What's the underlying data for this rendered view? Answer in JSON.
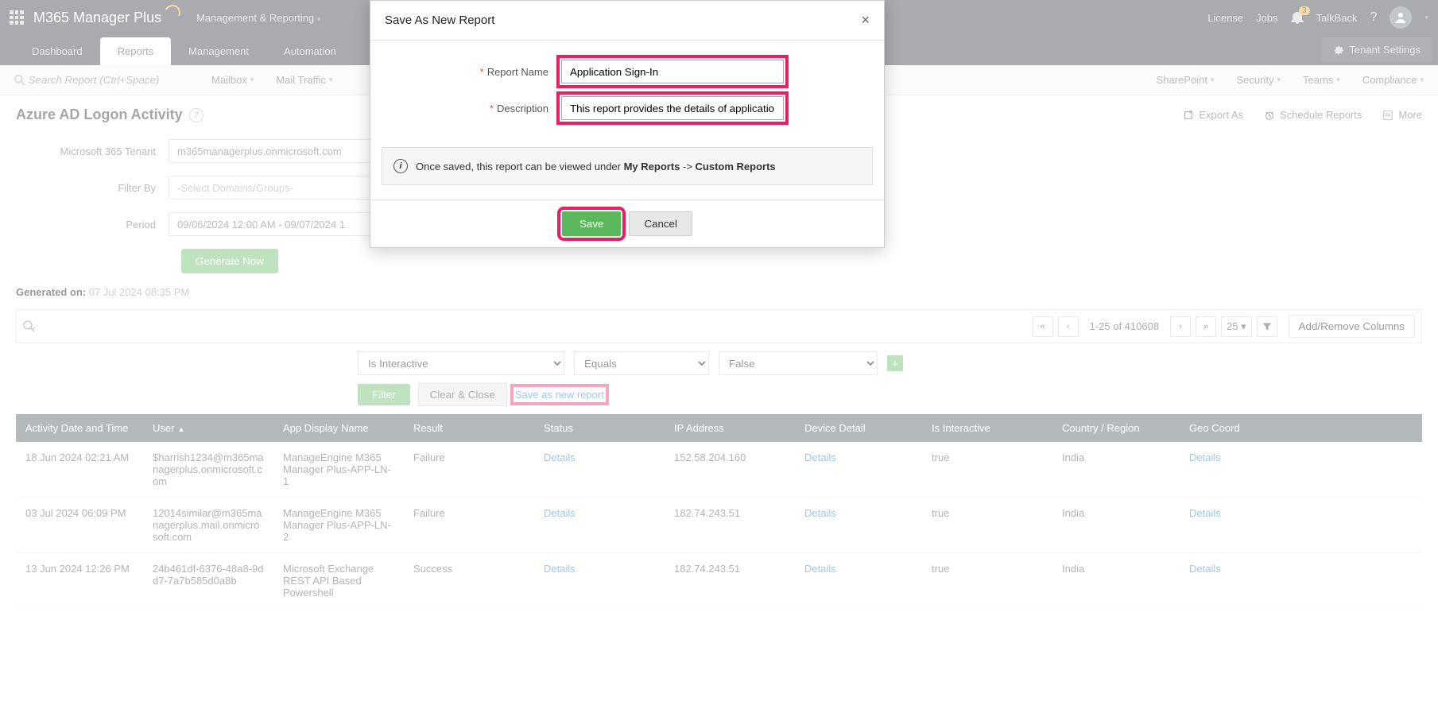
{
  "header": {
    "product": "M365 Manager Plus",
    "menu": "Management & Reporting",
    "links": {
      "license": "License",
      "jobs": "Jobs",
      "talkback": "TalkBack"
    },
    "notif_count": "3"
  },
  "tabs": {
    "dashboard": "Dashboard",
    "reports": "Reports",
    "management": "Management",
    "automation": "Automation",
    "tenant_settings": "Tenant Settings"
  },
  "subnav": {
    "search_placeholder": "Search Report (Ctrl+Space)",
    "mailbox": "Mailbox",
    "mail_traffic": "Mail Traffic",
    "sharepoint": "SharePoint",
    "security": "Security",
    "teams": "Teams",
    "compliance": "Compliance"
  },
  "page": {
    "title": "Azure AD Logon Activity",
    "export_as": "Export As",
    "schedule": "Schedule Reports",
    "more": "More"
  },
  "form": {
    "tenant_label": "Microsoft 365 Tenant",
    "tenant_value": "m365managerplus.onmicrosoft.com",
    "filterby_label": "Filter By",
    "filterby_value": "-Select Domains/Groups-",
    "period_label": "Period",
    "period_value": "09/06/2024 12:00 AM - 09/07/2024 1",
    "generate": "Generate Now"
  },
  "generated": {
    "label": "Generated on:",
    "value": "07 Jul 2024 08:35 PM"
  },
  "toolbar": {
    "range": "1-25 of 410608",
    "page_size": "25",
    "add_cols": "Add/Remove Columns"
  },
  "filter_controls": {
    "field": "Is Interactive",
    "op": "Equals",
    "value": "False",
    "filter": "Filter",
    "clear": "Clear & Close",
    "save_new": "Save as new report"
  },
  "columns": [
    "Activity Date and Time",
    "User",
    "App Display Name",
    "Result",
    "Status",
    "IP Address",
    "Device Detail",
    "Is Interactive",
    "Country / Region",
    "Geo Coord"
  ],
  "rows": [
    {
      "dt": "18 Jun 2024 02:21 AM",
      "user": "$harrish1234@m365managerplus.onmicrosoft.com",
      "app": "ManageEngine M365 Manager Plus-APP-LN-1",
      "result": "Failure",
      "status": "Details",
      "ip": "152.58.204.160",
      "device": "Details",
      "interactive": "true",
      "country": "India",
      "geo": "Details"
    },
    {
      "dt": "03 Jul 2024 06:09 PM",
      "user": "12014similar@m365managerplus.mail.onmicrosoft.com",
      "app": "ManageEngine M365 Manager Plus-APP-LN-2",
      "result": "Failure",
      "status": "Details",
      "ip": "182.74.243.51",
      "device": "Details",
      "interactive": "true",
      "country": "India",
      "geo": "Details"
    },
    {
      "dt": "13 Jun 2024 12:26 PM",
      "user": "24b461df-6376-48a8-9dd7-7a7b585d0a8b",
      "app": "Microsoft Exchange REST API Based Powershell",
      "result": "Success",
      "status": "Details",
      "ip": "182.74.243.51",
      "device": "Details",
      "interactive": "true",
      "country": "India",
      "geo": "Details"
    }
  ],
  "modal": {
    "title": "Save As New Report",
    "report_name_label": "Report Name",
    "report_name_value": "Application Sign-In",
    "description_label": "Description",
    "description_value": "This report provides the details of applicatio",
    "info_pre": "Once saved, this report can be viewed under ",
    "info_b1": "My Reports",
    "info_mid": " -> ",
    "info_b2": "Custom Reports",
    "save": "Save",
    "cancel": "Cancel"
  }
}
